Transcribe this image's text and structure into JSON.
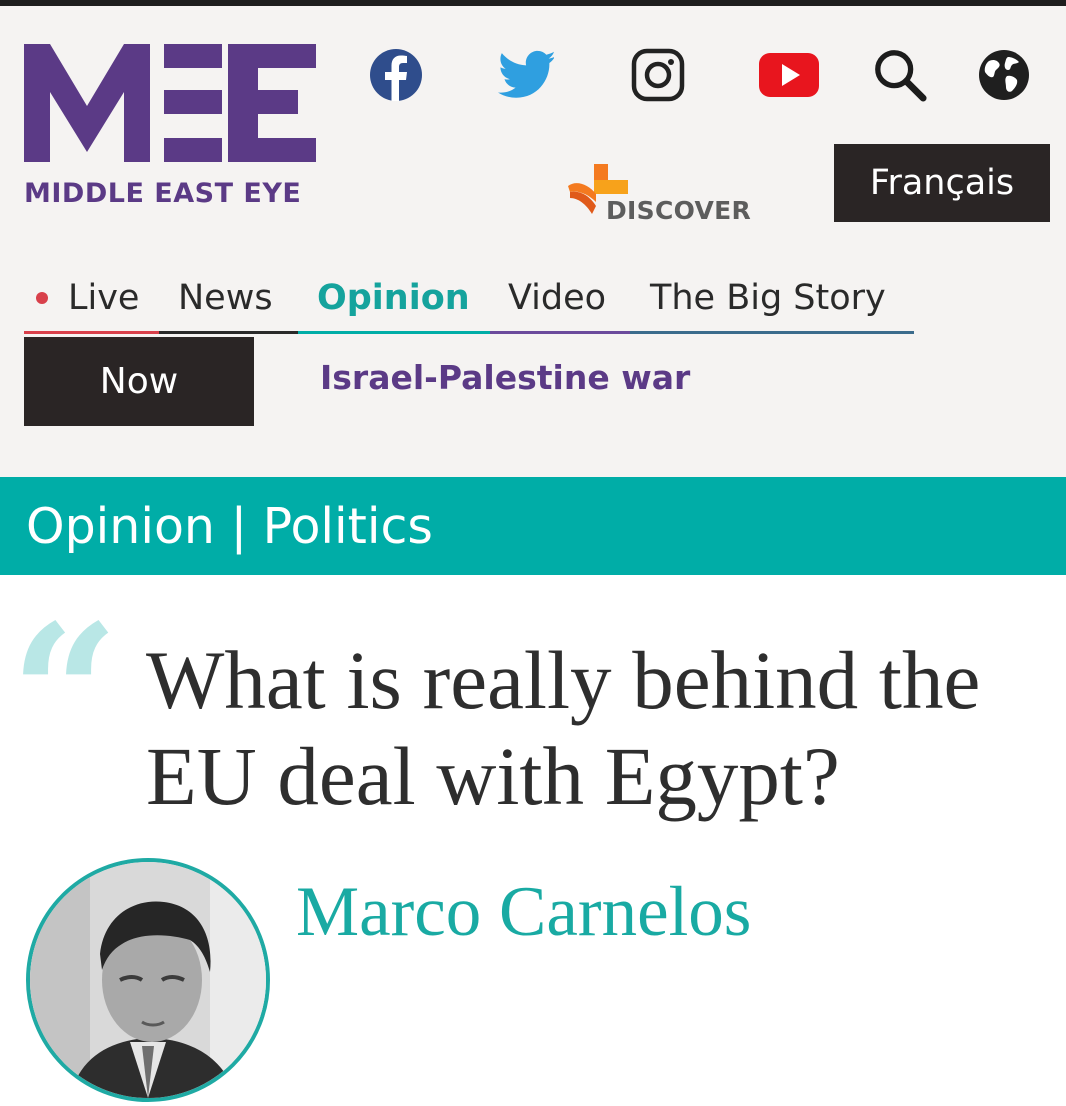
{
  "brand": {
    "name": "MIDDLE EAST EYE",
    "primary_color": "#5b3a86",
    "accent_color": "#00ada7"
  },
  "header": {
    "social_icons": [
      "facebook-icon",
      "twitter-icon",
      "instagram-icon",
      "youtube-icon",
      "search-icon",
      "globe-icon"
    ],
    "discover_label": "DISCOVER",
    "language_button": "Français"
  },
  "nav": {
    "items": [
      {
        "label": "Live"
      },
      {
        "label": "News"
      },
      {
        "label": "Opinion"
      },
      {
        "label": "Video"
      },
      {
        "label": "The Big Story"
      }
    ],
    "now_label": "Now",
    "now_link": "Israel-Palestine war"
  },
  "section": {
    "label": "Opinion | Politics"
  },
  "article": {
    "headline": "What is really behind the EU deal with Egypt?",
    "author": "Marco Carnelos"
  }
}
